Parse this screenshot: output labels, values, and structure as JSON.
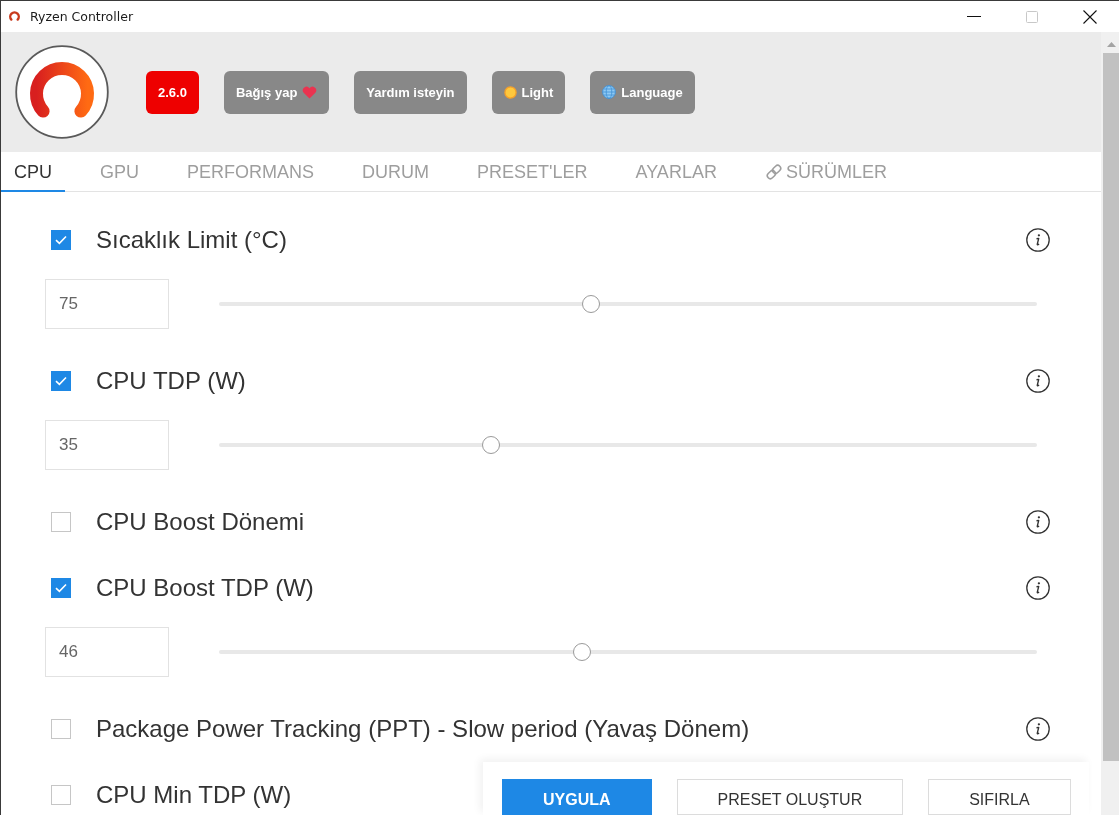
{
  "window": {
    "title": "Ryzen Controller",
    "controls": [
      {
        "kind": "minimize",
        "disabled": false
      },
      {
        "kind": "maximize",
        "disabled": true
      },
      {
        "kind": "close",
        "disabled": false
      }
    ]
  },
  "header": {
    "buttons": [
      {
        "kind": "version",
        "label": "2.6.0",
        "color": "#ee0000"
      },
      {
        "kind": "donate",
        "label": "Bağış yap",
        "color": "#888888"
      },
      {
        "kind": "help",
        "label": "Yardım isteyin",
        "color": "#888888"
      },
      {
        "kind": "theme",
        "label": "Light",
        "color": "#888888"
      },
      {
        "kind": "language",
        "label": "Language",
        "color": "#888888"
      }
    ]
  },
  "tabs": [
    {
      "kind": "tab",
      "label": "CPU",
      "selected": true
    },
    {
      "kind": "tab",
      "label": "GPU",
      "selected": false
    },
    {
      "kind": "tab",
      "label": "PERFORMANS",
      "selected": false
    },
    {
      "kind": "tab",
      "label": "DURUM",
      "selected": false
    },
    {
      "kind": "tab",
      "label": "PRESET'LER",
      "selected": false
    },
    {
      "kind": "tab",
      "label": "AYARLAR",
      "selected": false
    },
    {
      "kind": "link",
      "label": "SÜRÜMLER",
      "selected": false
    }
  ],
  "settings": [
    {
      "label": "Sıcaklık Limit (°C)",
      "checked": true,
      "value": "75",
      "level": 0.455,
      "info_icon": true
    },
    {
      "label": "CPU TDP (W)",
      "checked": true,
      "value": "35",
      "level": 0.333,
      "info_icon": true
    },
    {
      "label": "CPU Boost Dönemi",
      "checked": false,
      "info_icon": true
    },
    {
      "label": "CPU Boost TDP (W)",
      "checked": true,
      "value": "46",
      "level": 0.444,
      "info_icon": true
    },
    {
      "label": "Package Power Tracking (PPT) - Slow period (Yavaş Dönem)",
      "checked": false,
      "info_icon": true
    },
    {
      "label": "CPU Min TDP (W)",
      "checked": false,
      "info_icon": false
    }
  ],
  "actions": [
    {
      "kind": "primary",
      "label": "UYGULA"
    },
    {
      "kind": "secondary",
      "label": "PRESET OLUŞTUR"
    },
    {
      "kind": "secondary",
      "label": "SIFIRLA"
    }
  ]
}
